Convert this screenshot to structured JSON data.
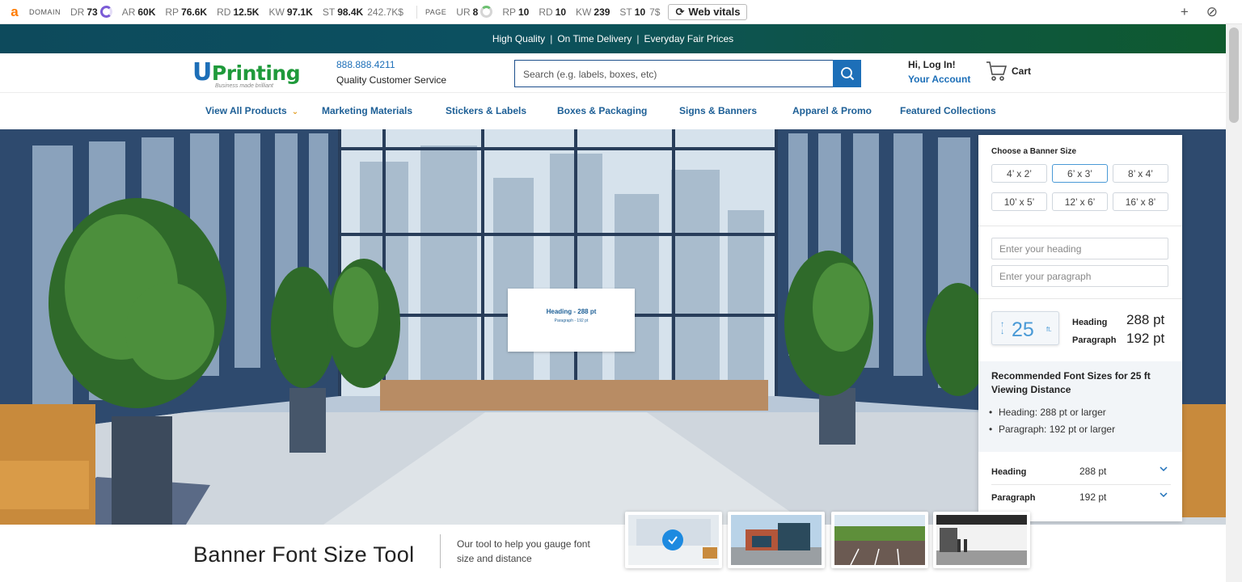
{
  "seo_toolbar": {
    "logo": "a",
    "domain_tag": "DOMAIN",
    "domain_metrics": [
      {
        "key": "DR",
        "value": "73"
      },
      {
        "key": "AR",
        "value": "60K"
      },
      {
        "key": "RP",
        "value": "76.6K"
      },
      {
        "key": "RD",
        "value": "12.5K"
      },
      {
        "key": "KW",
        "value": "97.1K"
      },
      {
        "key": "ST",
        "value": "98.4K",
        "extra": "242.7K$"
      }
    ],
    "page_tag": "PAGE",
    "page_metrics": [
      {
        "key": "UR",
        "value": "8"
      },
      {
        "key": "RP",
        "value": "10"
      },
      {
        "key": "RD",
        "value": "10"
      },
      {
        "key": "KW",
        "value": "239"
      },
      {
        "key": "ST",
        "value": "10",
        "extra": "7$"
      }
    ],
    "web_vitals_label": "Web vitals",
    "accent_color": "#7b5cd6"
  },
  "promo": {
    "items": [
      "High Quality",
      "On Time Delivery",
      "Everyday Fair Prices"
    ],
    "separator": "|"
  },
  "header": {
    "logo_text": "Printing",
    "logo_letter": "U",
    "logo_tagline": "Business made brilliant",
    "phone": "888.888.4211",
    "service_text": "Quality Customer Service",
    "search_placeholder": "Search (e.g. labels, boxes, etc)",
    "login_text": "Hi, Log In!",
    "account_text": "Your Account",
    "cart_label": "Cart",
    "brand_blue": "#1d6fb8",
    "brand_green": "#1f9a3b"
  },
  "nav": {
    "items": [
      {
        "label": "View All Products",
        "has_dropdown": true
      },
      {
        "label": "Marketing Materials"
      },
      {
        "label": "Stickers & Labels"
      },
      {
        "label": "Boxes & Packaging"
      },
      {
        "label": "Signs & Banners"
      },
      {
        "label": "Apparel & Promo"
      },
      {
        "label": "Featured Collections"
      }
    ]
  },
  "hero": {
    "preview_heading": "Heading - 288 pt",
    "preview_paragraph": "Paragraph - 192 pt"
  },
  "panel": {
    "title": "Choose a Banner Size",
    "sizes": [
      "4’ x 2’",
      "6’ x 3’",
      "8’ x 4’",
      "10’ x 5’",
      "12’ x 6’",
      "16’ x 8’"
    ],
    "selected_size": "6’ x 3’",
    "heading_placeholder": "Enter your heading",
    "paragraph_placeholder": "Enter your paragraph",
    "distance_value": "25",
    "distance_unit": "ft.",
    "heading_label": "Heading",
    "heading_value": "288 pt",
    "paragraph_label": "Paragraph",
    "paragraph_value": "192 pt",
    "rec_title": "Recommended Font Sizes for 25 ft Viewing Distance",
    "rec_items": [
      "Heading: 288 pt or larger",
      "Paragraph: 192 pt or larger"
    ],
    "select_heading_label": "Heading",
    "select_heading_value": "288 pt",
    "select_paragraph_label": "Paragraph",
    "select_paragraph_value": "192 pt"
  },
  "bottom": {
    "title": "Banner Font Size Tool",
    "subtitle": "Our tool to help you gauge font size and distance"
  },
  "thumbnails": [
    {
      "name": "lobby",
      "selected": true
    },
    {
      "name": "storefront",
      "selected": false
    },
    {
      "name": "outdoor-field",
      "selected": false
    },
    {
      "name": "gallery",
      "selected": false
    }
  ]
}
